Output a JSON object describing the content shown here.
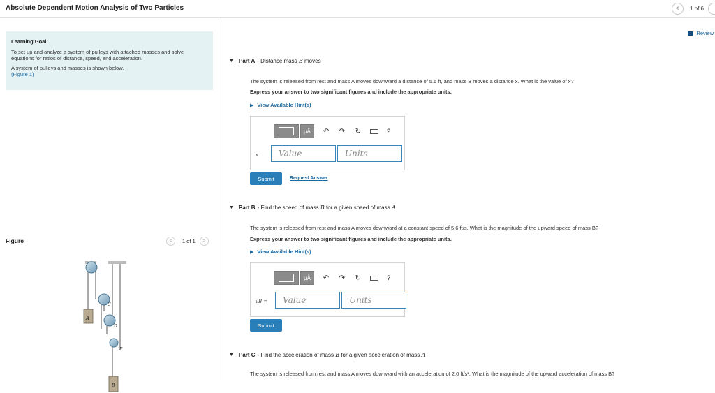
{
  "header": {
    "title": "Absolute Dependent Motion Analysis of Two Particles",
    "pager": "1 of 6",
    "prev_icon": "<"
  },
  "goal": {
    "title": "Learning Goal:",
    "text1": "To set up and analyze a system of pulleys with attached masses and solve equations for ratios of distance, speed, and acceleration.",
    "text2": "A system of pulleys and masses is shown below.",
    "figure_link": "(Figure 1)"
  },
  "figure": {
    "label": "Figure",
    "pager": "1 of 1",
    "prev": "<",
    "next": ">",
    "labels": {
      "A": "A",
      "B": "B",
      "C": "C",
      "D": "D",
      "E": "E"
    }
  },
  "review": "Review",
  "parts": [
    {
      "caret": "▼",
      "title": "Part A",
      "sep": " - ",
      "desc_pre": "Distance mass ",
      "desc_var": "B",
      "desc_post": " moves",
      "prompt": "The system is released from rest and mass A moves downward a distance of 5.6 ft, and mass B moves a distance x. What is the value of x?",
      "instruction": "Express your answer to two significant figures and include the appropriate units.",
      "hint": "View Available Hint(s)",
      "var_label": "x",
      "value_placeholder": "Value",
      "units_placeholder": "Units",
      "submit": "Submit",
      "request": "Request Answer"
    },
    {
      "caret": "▼",
      "title": "Part B",
      "sep": " - ",
      "desc_pre": "Find the speed of mass ",
      "desc_var": "B",
      "desc_mid": " for a given speed of mass ",
      "desc_var2": "A",
      "prompt": "The system is released from rest and mass A moves downward at a constant speed of 5.6 ft/s. What is the magnitude of the upward speed of mass B?",
      "instruction": "Express your answer to two significant figures and include the appropriate units.",
      "hint": "View Available Hint(s)",
      "var_label": "vB =",
      "value_placeholder": "Value",
      "units_placeholder": "Units",
      "submit": "Submit"
    },
    {
      "caret": "▼",
      "title": "Part C",
      "sep": " - ",
      "desc_pre": "Find the acceleration of mass ",
      "desc_var": "B",
      "desc_mid": " for a given acceleration of mass ",
      "desc_var2": "A",
      "prompt": "The system is released from rest and mass A moves downward with an acceleration of 2.0 ft/s². What is the magnitude of the upward acceleration of mass B?"
    }
  ],
  "toolbar": {
    "mu": "μÅ",
    "undo": "↶",
    "redo": "↷",
    "reset": "↻",
    "help": "?"
  },
  "colors": {
    "accent": "#2a7fb8",
    "link": "#1a6aa3",
    "goal_bg": "#e4f2f4"
  }
}
